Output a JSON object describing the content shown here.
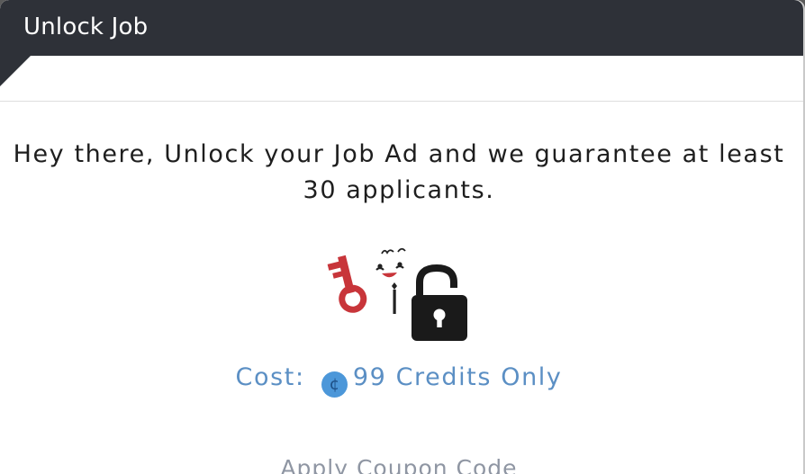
{
  "header": {
    "title": "Unlock Job"
  },
  "body": {
    "message": "Hey there, Unlock your Job Ad and we guarantee at least 30 applicants.",
    "illustration_icons": [
      "key-icon",
      "mascot-icon",
      "padlock-icon"
    ],
    "cost": {
      "prefix": "Cost:",
      "currency_icon": "credit-coin-icon",
      "currency_symbol": "¢",
      "amount_text": "99 Credits Only"
    },
    "coupon_link": "Apply Coupon Code"
  },
  "colors": {
    "header_bg": "#2e3138",
    "cost_text": "#5b8fc4",
    "key": "#c8353a",
    "padlock": "#1a1a1a"
  }
}
